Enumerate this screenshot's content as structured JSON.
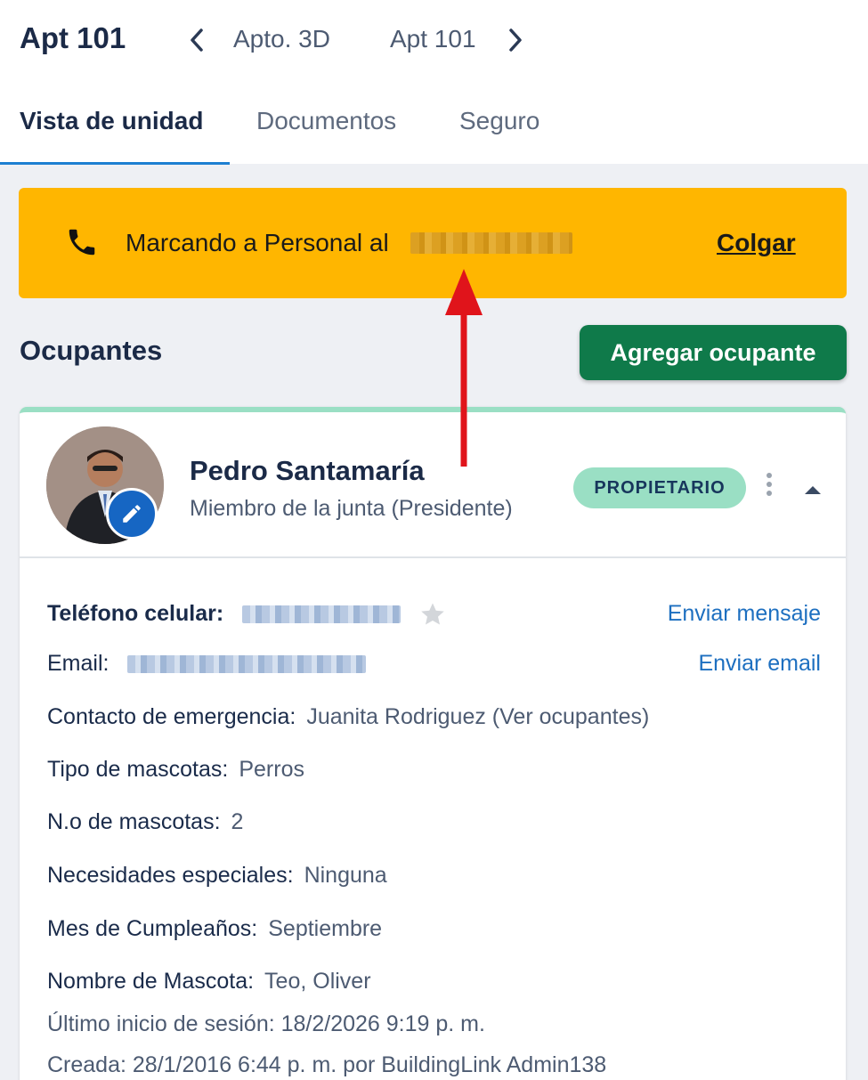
{
  "header": {
    "unit_title": "Apt 101",
    "prev_unit": "Apto. 3D",
    "next_unit": "Apt 101"
  },
  "tabs": [
    {
      "label": "Vista de unidad",
      "active": true
    },
    {
      "label": "Documentos",
      "active": false
    },
    {
      "label": "Seguro",
      "active": false
    }
  ],
  "call_banner": {
    "text": "Marcando a Personal al",
    "hangup_label": "Colgar",
    "color": "#ffb600"
  },
  "occupants_section": {
    "title": "Ocupantes",
    "add_button_label": "Agregar ocupante"
  },
  "occupant": {
    "name": "Pedro Santamaría",
    "role": "Miembro de la junta (Presidente)",
    "badge": "PROPIETARIO",
    "fields": {
      "cell_phone_label": "Teléfono celular:",
      "send_message_label": "Enviar mensaje",
      "email_label": "Email:",
      "send_email_label": "Enviar email",
      "emergency_label": "Contacto de emergencia:",
      "emergency_value": "Juanita Rodriguez (Ver ocupantes)",
      "pet_type_label": "Tipo de mascotas:",
      "pet_type_value": "Perros",
      "pet_count_label": "N.o de mascotas:",
      "pet_count_value": "2",
      "special_needs_label": "Necesidades especiales:",
      "special_needs_value": "Ninguna",
      "birthday_label": "Mes de Cumpleaños:",
      "birthday_value": "Septiembre",
      "pet_name_label": "Nombre de Mascota:",
      "pet_name_value": "Teo, Oliver"
    },
    "last_login": "Último inicio de sesión:  18/2/2026 9:19 p. m.",
    "created": "Creada:  28/1/2016 6:44 p. m. por BuildingLink Admin138"
  },
  "colors": {
    "accent": "#1d7fd1",
    "primary_button": "#0f7a4a",
    "badge": "#9adfc4",
    "link": "#1d6fc0",
    "annotation_arrow": "#e0141b"
  }
}
